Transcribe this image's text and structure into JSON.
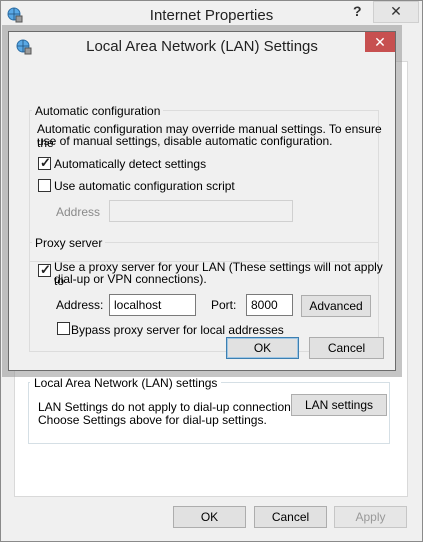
{
  "outer": {
    "title": "Internet Properties",
    "help_glyph": "?",
    "close_glyph": "✕",
    "lan_group_title": "Local Area Network (LAN) settings",
    "lan_desc_line1": "LAN Settings do not apply to dial-up connections.",
    "lan_desc_line2": "Choose Settings above for dial-up settings.",
    "lan_settings_button": "LAN settings",
    "ok": "OK",
    "cancel": "Cancel",
    "apply": "Apply"
  },
  "dialog": {
    "title": "Local Area Network (LAN) Settings",
    "close_glyph": "✕",
    "auto_group_title": "Automatic configuration",
    "auto_desc_line1": "Automatic configuration may override manual settings.  To ensure the",
    "auto_desc_line2": "use of manual settings, disable automatic configuration.",
    "auto_detect_label": "Automatically detect settings",
    "auto_detect_checked": true,
    "auto_script_label": "Use automatic configuration script",
    "auto_script_checked": false,
    "address_label": "Address",
    "address_value": "",
    "proxy_group_title": "Proxy server",
    "proxy_use_line1": "Use a proxy server for your LAN (These settings will not apply to",
    "proxy_use_line2": "dial-up or VPN connections).",
    "proxy_use_checked": true,
    "proxy_address_label": "Address:",
    "proxy_address_value": "localhost",
    "proxy_port_label": "Port:",
    "proxy_port_value": "8000",
    "advanced_button": "Advanced",
    "bypass_label": "Bypass proxy server for local addresses",
    "bypass_checked": false,
    "ok": "OK",
    "cancel": "Cancel",
    "checkmark_glyph": "✓"
  },
  "colors": {
    "close_red": "#c75050",
    "default_button_border": "#3c7fb1"
  },
  "icons": [
    "globe-settings-icon",
    "help-icon",
    "close-icon"
  ]
}
